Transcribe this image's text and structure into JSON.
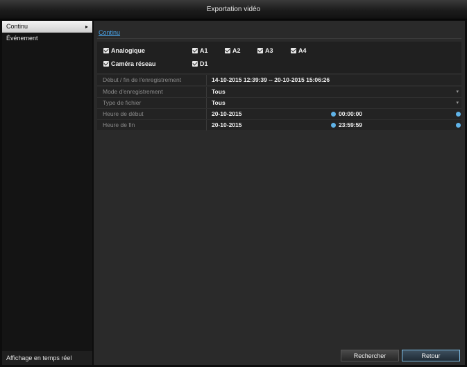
{
  "window": {
    "title": "Exportation vidéo"
  },
  "sidebar": {
    "items": [
      {
        "label": "Continu",
        "active": true
      },
      {
        "label": "Événement",
        "active": false
      }
    ],
    "bottom_label": "Affichage en temps réel"
  },
  "tabs": [
    {
      "label": "Continu"
    }
  ],
  "channels": {
    "analog": {
      "label": "Analogique",
      "checked": true
    },
    "network": {
      "label": "Caméra réseau",
      "checked": true
    },
    "analog_channels": [
      "A1",
      "A2",
      "A3",
      "A4"
    ],
    "network_channels": [
      "D1"
    ]
  },
  "form": {
    "range": {
      "label": "Début / fin de l'enregistrement",
      "value": "14-10-2015 12:39:39 -- 20-10-2015 15:06:26"
    },
    "record_mode": {
      "label": "Mode d'enregistrement",
      "value": "Tous"
    },
    "file_type": {
      "label": "Type de fichier",
      "value": "Tous"
    },
    "start": {
      "label": "Heure de début",
      "date": "20-10-2015",
      "time": "00:00:00"
    },
    "end": {
      "label": "Heure de fin",
      "date": "20-10-2015",
      "time": "23:59:59"
    }
  },
  "buttons": {
    "search": "Rechercher",
    "back": "Retour"
  },
  "colors": {
    "accent": "#5fb3e8",
    "tab_link": "#4aa3e8",
    "panel": "#2a2a2a"
  }
}
